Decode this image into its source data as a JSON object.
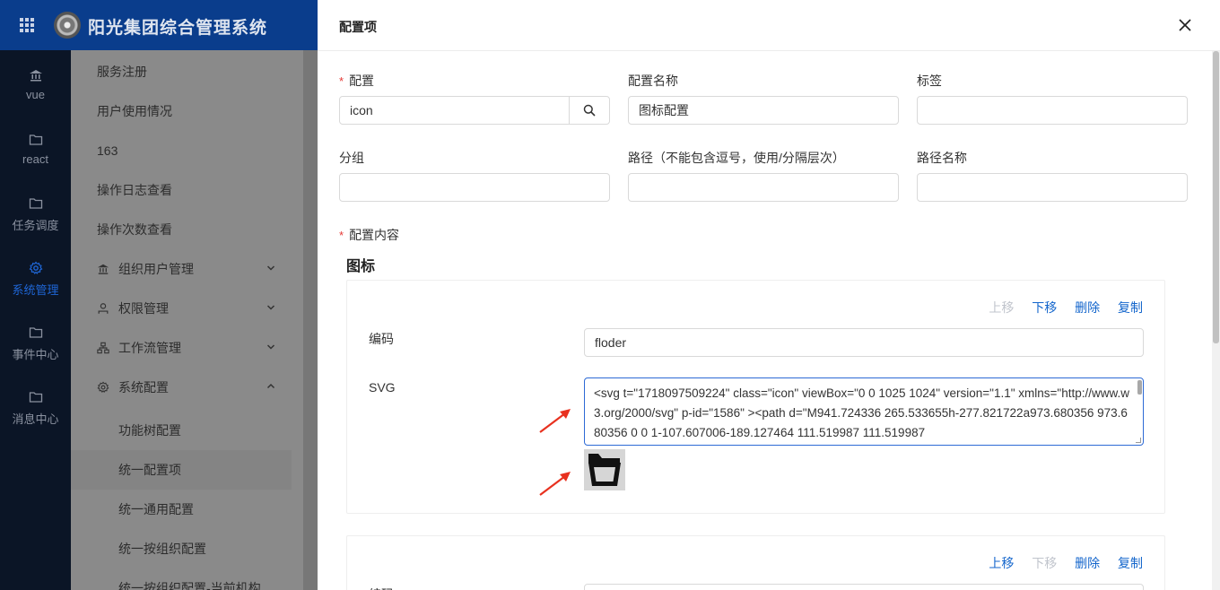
{
  "app": {
    "title": "阳光集团综合管理系统"
  },
  "rail": [
    {
      "label": "vue",
      "icon": "bank-icon",
      "active": false
    },
    {
      "label": "react",
      "icon": "folder-icon",
      "active": false
    },
    {
      "label": "任务调度",
      "icon": "folder-icon",
      "active": false
    },
    {
      "label": "系统管理",
      "icon": "gear-icon",
      "active": true
    },
    {
      "label": "事件中心",
      "icon": "folder-icon",
      "active": false
    },
    {
      "label": "消息中心",
      "icon": "folder-icon",
      "active": false
    }
  ],
  "menu": {
    "items": [
      {
        "label": "服务注册"
      },
      {
        "label": "用户使用情况"
      },
      {
        "label": "163"
      },
      {
        "label": "操作日志查看"
      },
      {
        "label": "操作次数查看"
      }
    ],
    "groups": [
      {
        "label": "组织用户管理",
        "icon": "bank-icon"
      },
      {
        "label": "权限管理",
        "icon": "user-icon"
      },
      {
        "label": "工作流管理",
        "icon": "share-icon"
      },
      {
        "label": "系统配置",
        "icon": "gear-icon",
        "expanded": true
      }
    ],
    "subitems": [
      {
        "label": "功能树配置"
      },
      {
        "label": "统一配置项",
        "selected": true
      },
      {
        "label": "统一通用配置"
      },
      {
        "label": "统一按组织配置"
      },
      {
        "label": "统一按组织配置-当前机构"
      }
    ]
  },
  "drawer": {
    "title": "配置项",
    "fields": {
      "config_label": "配置",
      "config_value": "icon",
      "config_name_label": "配置名称",
      "config_name_value": "图标配置",
      "tag_label": "标签",
      "tag_value": "",
      "group_label": "分组",
      "group_value": "",
      "path_label": "路径（不能包含逗号，使用/分隔层次）",
      "path_value": "",
      "path_name_label": "路径名称",
      "path_name_value": "",
      "content_label": "配置内容"
    },
    "section_title": "图标",
    "card1": {
      "actions": {
        "up": "上移",
        "down": "下移",
        "delete": "删除",
        "copy": "复制"
      },
      "code_label": "编码",
      "code_value": "floder",
      "svg_label": "SVG",
      "svg_value": "<svg t=\"1718097509224\" class=\"icon\" viewBox=\"0 0 1025 1024\" version=\"1.1\" xmlns=\"http://www.w3.org/2000/svg\" p-id=\"1586\"  ><path d=\"M941.724336 265.533655h-277.821722a973.680356 973.680356 0 0 1-107.607006-189.127464 111.519987 111.519987"
    },
    "card2": {
      "actions": {
        "up": "上移",
        "down": "下移",
        "delete": "删除",
        "copy": "复制"
      },
      "code_label": "编码"
    }
  },
  "colors": {
    "primary": "#1466cc",
    "topbar": "#0a3d8c",
    "rail": "#0b1526",
    "required": "#e53935",
    "arrow": "#e8311f"
  }
}
